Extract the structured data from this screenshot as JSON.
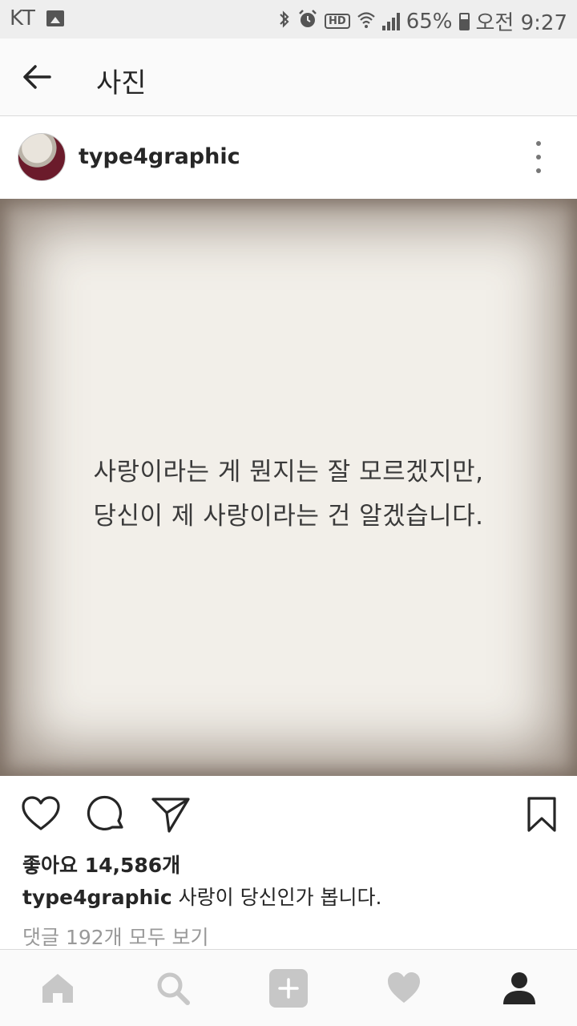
{
  "status_bar": {
    "carrier": "KT",
    "battery": "65%",
    "time": "오전 9:27",
    "hd_badge": "HD",
    "icons": [
      "gallery-icon",
      "bluetooth-icon",
      "alarm-icon",
      "hd-voice-icon",
      "wifi-icon",
      "signal-icon",
      "battery-icon"
    ]
  },
  "header": {
    "title": "사진",
    "back_icon": "arrow-left-icon"
  },
  "post": {
    "username": "type4graphic",
    "more_icon": "more-vertical-icon",
    "image_text": {
      "line1": "사랑이라는 게 뭔지는 잘 모르겠지만,",
      "line2": "당신이 제 사랑이라는 건 알겠습니다."
    },
    "likes": "좋아요 14,586개",
    "caption_user": "type4graphic",
    "caption_text": "사랑이 당신인가 봅니다.",
    "comments_link": "댓글 192개 모두 보기"
  },
  "actions": {
    "icons": [
      "heart-icon",
      "comment-icon",
      "share-icon",
      "bookmark-icon"
    ]
  },
  "bottom_nav": {
    "items": [
      "home-icon",
      "search-icon",
      "add-icon",
      "activity-heart-icon",
      "profile-icon"
    ],
    "active": "profile-icon"
  }
}
